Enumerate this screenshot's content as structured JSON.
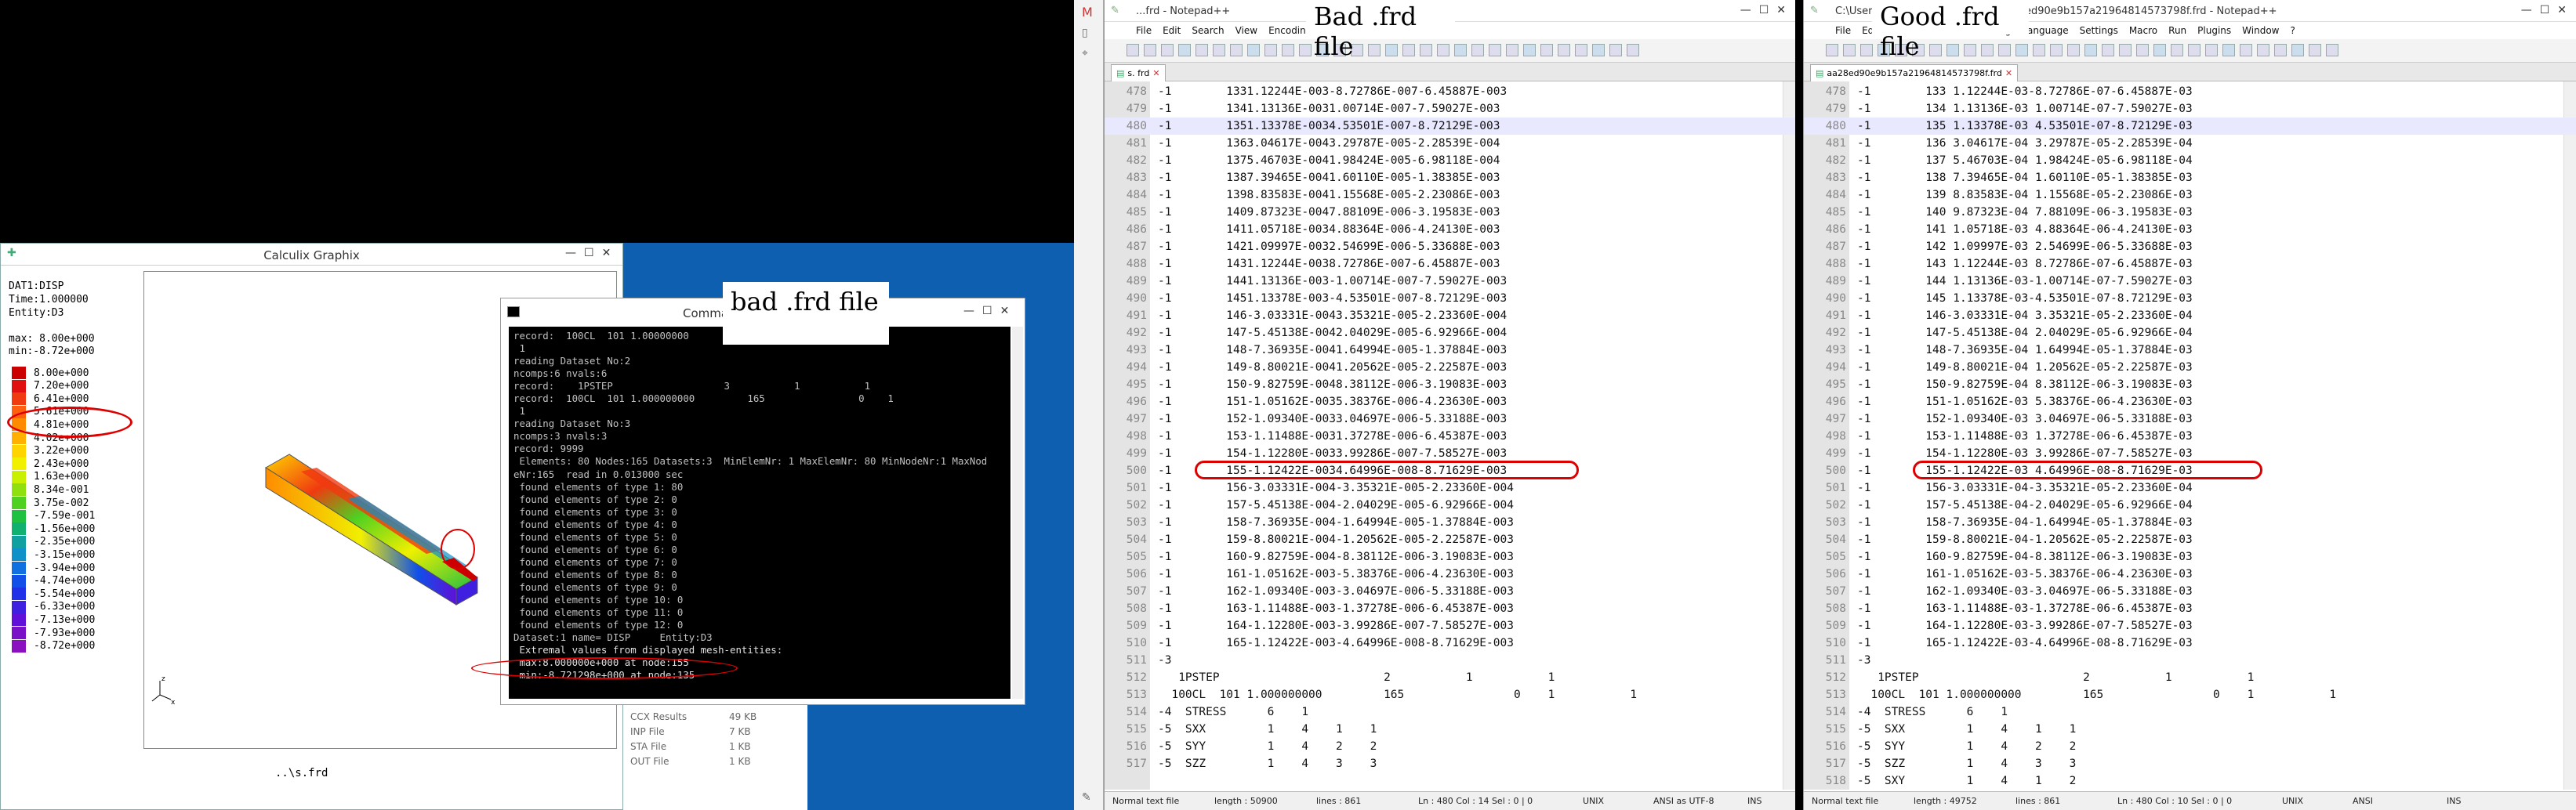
{
  "labels": {
    "bad_top": "Bad .frd file",
    "good_top": "Good .frd file",
    "bad_cmd": "bad .frd file"
  },
  "calculix": {
    "title": "Calculix Graphix",
    "info": [
      "DAT1:DISP",
      "Time:1.000000",
      "Entity:D3"
    ],
    "max_label": "max: 8.00e+000",
    "min_label": "min:-8.72e+000",
    "legend": [
      {
        "value": "8.00e+000",
        "color": "#cc0000"
      },
      {
        "value": "7.20e+000",
        "color": "#e01010"
      },
      {
        "value": "6.41e+000",
        "color": "#f03a10"
      },
      {
        "value": "5.61e+000",
        "color": "#ff6010"
      },
      {
        "value": "4.81e+000",
        "color": "#ff8c00"
      },
      {
        "value": "4.02e+000",
        "color": "#ffb000"
      },
      {
        "value": "3.22e+000",
        "color": "#ffd400"
      },
      {
        "value": "2.43e+000",
        "color": "#f0f000"
      },
      {
        "value": "1.63e+000",
        "color": "#c8f000"
      },
      {
        "value": "8.34e-001",
        "color": "#90e010"
      },
      {
        "value": "3.75e-002",
        "color": "#50d020"
      },
      {
        "value": "-7.59e-001",
        "color": "#20c040"
      },
      {
        "value": "-1.56e+000",
        "color": "#10b070"
      },
      {
        "value": "-2.35e+000",
        "color": "#10a0a0"
      },
      {
        "value": "-3.15e+000",
        "color": "#1090c8"
      },
      {
        "value": "-3.94e+000",
        "color": "#1070e0"
      },
      {
        "value": "-4.74e+000",
        "color": "#1050e8"
      },
      {
        "value": "-5.54e+000",
        "color": "#2030e8"
      },
      {
        "value": "-6.33e+000",
        "color": "#4020e0"
      },
      {
        "value": "-7.13e+000",
        "color": "#6010d8"
      },
      {
        "value": "-7.93e+000",
        "color": "#7a10c8"
      },
      {
        "value": "-8.72e+000",
        "color": "#8a10c0"
      }
    ],
    "file": "..\\s.frd"
  },
  "explorer": {
    "rows": [
      {
        "name": "CCX Results",
        "size": "49 KB"
      },
      {
        "name": "INP File",
        "size": "7 KB"
      },
      {
        "name": "STA File",
        "size": "1 KB"
      },
      {
        "name": "OUT File",
        "size": "1 KB"
      }
    ]
  },
  "cmd": {
    "title": "Comma",
    "lines": [
      "record:  100CL  101 1.00000000         165                0    1",
      " 1",
      "reading Dataset No:2",
      "ncomps:6 nvals:6",
      "record:    1PSTEP                   3           1           1",
      "record:  100CL  101 1.000000000         165                0    1",
      " 1",
      "reading Dataset No:3",
      "ncomps:3 nvals:3",
      "record: 9999",
      " Elements: 80 Nodes:165 Datasets:3  MinElemNr: 1 MaxElemNr: 80 MinNodeNr:1 MaxNod",
      "eNr:165  read in 0.013000 sec",
      " found elements of type 1: 80",
      " found elements of type 2: 0",
      " found elements of type 3: 0",
      " found elements of type 4: 0",
      " found elements of type 5: 0",
      " found elements of type 6: 0",
      " found elements of type 7: 0",
      " found elements of type 8: 0",
      " found elements of type 9: 0",
      " found elements of type 10: 0",
      " found elements of type 11: 0",
      " found elements of type 12: 0",
      "",
      "Dataset:1 name= DISP     Entity:D3",
      " Extremal values from displayed mesh-entities:",
      " max:8.000000e+000 at node:155",
      " min:-8.721298e+000 at node:135"
    ]
  },
  "notepad_bad": {
    "title": "...frd - Notepad++",
    "menu": [
      "File",
      "Edit",
      "Search",
      "View",
      "Encoding",
      "Langua",
      "Window"
    ],
    "tab": "s. frd",
    "lines": [
      [
        "478",
        "-1        1331.12244E-003-8.72786E-007-6.45887E-003"
      ],
      [
        "479",
        "-1        1341.13136E-0031.00714E-007-7.59027E-003"
      ],
      [
        "480",
        "-1        1351.13378E-0034.53501E-007-8.72129E-003"
      ],
      [
        "481",
        "-1        1363.04617E-0043.29787E-005-2.28539E-004"
      ],
      [
        "482",
        "-1        1375.46703E-0041.98424E-005-6.98118E-004"
      ],
      [
        "483",
        "-1        1387.39465E-0041.60110E-005-1.38385E-003"
      ],
      [
        "484",
        "-1        1398.83583E-0041.15568E-005-2.23086E-003"
      ],
      [
        "485",
        "-1        1409.87323E-0047.88109E-006-3.19583E-003"
      ],
      [
        "486",
        "-1        1411.05718E-0034.88364E-006-4.24130E-003"
      ],
      [
        "487",
        "-1        1421.09997E-0032.54699E-006-5.33688E-003"
      ],
      [
        "488",
        "-1        1431.12244E-0038.72786E-007-6.45887E-003"
      ],
      [
        "489",
        "-1        1441.13136E-003-1.00714E-007-7.59027E-003"
      ],
      [
        "490",
        "-1        1451.13378E-003-4.53501E-007-8.72129E-003"
      ],
      [
        "491",
        "-1        146-3.03331E-0043.35321E-005-2.23360E-004"
      ],
      [
        "492",
        "-1        147-5.45138E-0042.04029E-005-6.92966E-004"
      ],
      [
        "493",
        "-1        148-7.36935E-0041.64994E-005-1.37884E-003"
      ],
      [
        "494",
        "-1        149-8.80021E-0041.20562E-005-2.22587E-003"
      ],
      [
        "495",
        "-1        150-9.82759E-0048.38112E-006-3.19083E-003"
      ],
      [
        "496",
        "-1        151-1.05162E-0035.38376E-006-4.23630E-003"
      ],
      [
        "497",
        "-1        152-1.09340E-0033.04697E-006-5.33188E-003"
      ],
      [
        "498",
        "-1        153-1.11488E-0031.37278E-006-6.45387E-003"
      ],
      [
        "499",
        "-1        154-1.12280E-0033.99286E-007-7.58527E-003"
      ],
      [
        "500",
        "-1        155-1.12422E-0034.64996E-008-8.71629E-003"
      ],
      [
        "501",
        "-1        156-3.03331E-004-3.35321E-005-2.23360E-004"
      ],
      [
        "502",
        "-1        157-5.45138E-004-2.04029E-005-6.92966E-004"
      ],
      [
        "503",
        "-1        158-7.36935E-004-1.64994E-005-1.37884E-003"
      ],
      [
        "504",
        "-1        159-8.80021E-004-1.20562E-005-2.22587E-003"
      ],
      [
        "505",
        "-1        160-9.82759E-004-8.38112E-006-3.19083E-003"
      ],
      [
        "506",
        "-1        161-1.05162E-003-5.38376E-006-4.23630E-003"
      ],
      [
        "507",
        "-1        162-1.09340E-003-3.04697E-006-5.33188E-003"
      ],
      [
        "508",
        "-1        163-1.11488E-003-1.37278E-006-6.45387E-003"
      ],
      [
        "509",
        "-1        164-1.12280E-003-3.99286E-007-7.58527E-003"
      ],
      [
        "510",
        "-1        165-1.12422E-003-4.64996E-008-8.71629E-003"
      ],
      [
        "511",
        "-3"
      ],
      [
        "512",
        "   1PSTEP                        2           1           1"
      ],
      [
        "513",
        "  100CL  101 1.000000000         165                0    1           1"
      ],
      [
        "514",
        "-4  STRESS      6    1"
      ],
      [
        "515",
        "-5  SXX         1    4    1    1"
      ],
      [
        "516",
        "-5  SYY         1    4    2    2"
      ],
      [
        "517",
        "-5  SZZ         1    4    3    3"
      ]
    ],
    "status": {
      "type": "Normal text file",
      "length": "length : 50900",
      "lines": "lines : 861",
      "pos": "Ln : 480   Col : 14   Sel : 0 | 0",
      "eol": "UNIX",
      "enc": "ANSI as UTF-8",
      "ins": "INS"
    }
  },
  "notepad_good": {
    "title": "C:\\Users\\...ance812729475\\Ccx\\aa28ed90e9b157a21964814573798f.frd - Notepad++",
    "menu": [
      "File",
      "Edit",
      "Search",
      "View",
      "Encoding",
      "Language",
      "Settings",
      "Macro",
      "Run",
      "Plugins",
      "Window",
      "?"
    ],
    "tab": "aa28ed90e9b157a21964814573798f.frd",
    "lines": [
      [
        "478",
        "-1        133 1.12244E-03-8.72786E-07-6.45887E-03"
      ],
      [
        "479",
        "-1        134 1.13136E-03 1.00714E-07-7.59027E-03"
      ],
      [
        "480",
        "-1        135 1.13378E-03 4.53501E-07-8.72129E-03"
      ],
      [
        "481",
        "-1        136 3.04617E-04 3.29787E-05-2.28539E-04"
      ],
      [
        "482",
        "-1        137 5.46703E-04 1.98424E-05-6.98118E-04"
      ],
      [
        "483",
        "-1        138 7.39465E-04 1.60110E-05-1.38385E-03"
      ],
      [
        "484",
        "-1        139 8.83583E-04 1.15568E-05-2.23086E-03"
      ],
      [
        "485",
        "-1        140 9.87323E-04 7.88109E-06-3.19583E-03"
      ],
      [
        "486",
        "-1        141 1.05718E-03 4.88364E-06-4.24130E-03"
      ],
      [
        "487",
        "-1        142 1.09997E-03 2.54699E-06-5.33688E-03"
      ],
      [
        "488",
        "-1        143 1.12244E-03 8.72786E-07-6.45887E-03"
      ],
      [
        "489",
        "-1        144 1.13136E-03-1.00714E-07-7.59027E-03"
      ],
      [
        "490",
        "-1        145 1.13378E-03-4.53501E-07-8.72129E-03"
      ],
      [
        "491",
        "-1        146-3.03331E-04 3.35321E-05-2.23360E-04"
      ],
      [
        "492",
        "-1        147-5.45138E-04 2.04029E-05-6.92966E-04"
      ],
      [
        "493",
        "-1        148-7.36935E-04 1.64994E-05-1.37884E-03"
      ],
      [
        "494",
        "-1        149-8.80021E-04 1.20562E-05-2.22587E-03"
      ],
      [
        "495",
        "-1        150-9.82759E-04 8.38112E-06-3.19083E-03"
      ],
      [
        "496",
        "-1        151-1.05162E-03 5.38376E-06-4.23630E-03"
      ],
      [
        "497",
        "-1        152-1.09340E-03 3.04697E-06-5.33188E-03"
      ],
      [
        "498",
        "-1        153-1.11488E-03 1.37278E-06-6.45387E-03"
      ],
      [
        "499",
        "-1        154-1.12280E-03 3.99286E-07-7.58527E-03"
      ],
      [
        "500",
        "-1        155-1.12422E-03 4.64996E-08-8.71629E-03"
      ],
      [
        "501",
        "-1        156-3.03331E-04-3.35321E-05-2.23360E-04"
      ],
      [
        "502",
        "-1        157-5.45138E-04-2.04029E-05-6.92966E-04"
      ],
      [
        "503",
        "-1        158-7.36935E-04-1.64994E-05-1.37884E-03"
      ],
      [
        "504",
        "-1        159-8.80021E-04-1.20562E-05-2.22587E-03"
      ],
      [
        "505",
        "-1        160-9.82759E-04-8.38112E-06-3.19083E-03"
      ],
      [
        "506",
        "-1        161-1.05162E-03-5.38376E-06-4.23630E-03"
      ],
      [
        "507",
        "-1        162-1.09340E-03-3.04697E-06-5.33188E-03"
      ],
      [
        "508",
        "-1        163-1.11488E-03-1.37278E-06-6.45387E-03"
      ],
      [
        "509",
        "-1        164-1.12280E-03-3.99286E-07-7.58527E-03"
      ],
      [
        "510",
        "-1        165-1.12422E-03-4.64996E-08-8.71629E-03"
      ],
      [
        "511",
        "-3"
      ],
      [
        "512",
        "   1PSTEP                        2           1           1"
      ],
      [
        "513",
        "  100CL  101 1.000000000         165                0    1           1"
      ],
      [
        "514",
        "-4  STRESS      6    1"
      ],
      [
        "515",
        "-5  SXX         1    4    1    1"
      ],
      [
        "516",
        "-5  SYY         1    4    2    2"
      ],
      [
        "517",
        "-5  SZZ         1    4    3    3"
      ],
      [
        "518",
        "-5  SXY         1    4    1    2"
      ]
    ],
    "status": {
      "type": "Normal text file",
      "length": "length : 49752",
      "lines": "lines : 861",
      "pos": "Ln : 480   Col : 10   Sel : 0 | 0",
      "eol": "UNIX",
      "enc": "ANSI",
      "ins": "INS"
    }
  }
}
